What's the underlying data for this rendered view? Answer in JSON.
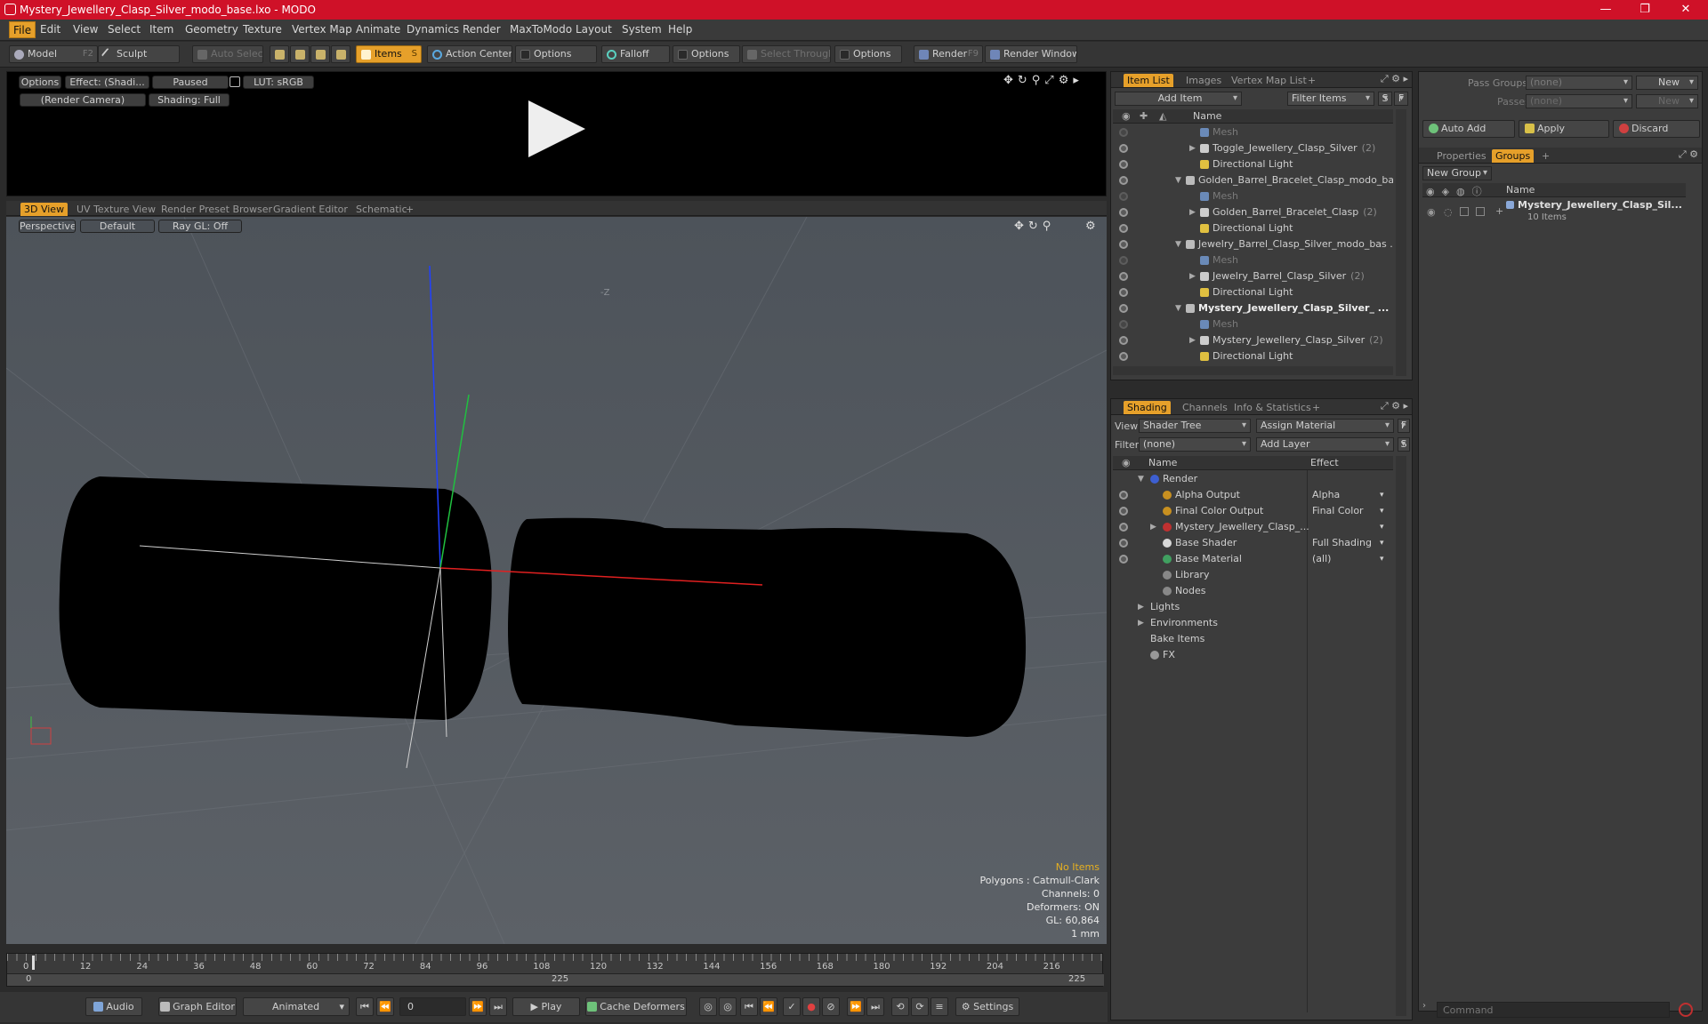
{
  "window": {
    "title": "Mystery_Jewellery_Clasp_Silver_modo_base.lxo - MODO"
  },
  "menu": [
    "File",
    "Edit",
    "View",
    "Select",
    "Item",
    "Geometry",
    "Texture",
    "Vertex Map",
    "Animate",
    "Dynamics",
    "Render",
    "MaxToModo",
    "Layout",
    "System",
    "Help"
  ],
  "toolbar": {
    "model": "Model",
    "model_key": "F2",
    "sculpt": "Sculpt",
    "auto_select": "Auto Select",
    "items": "Items",
    "items_key": "S",
    "action_center": "Action Center",
    "options1": "Options",
    "falloff": "Falloff",
    "options2": "Options",
    "select_through": "Select Through",
    "options3": "Options",
    "render": "Render",
    "render_key": "F9",
    "render_window": "Render Window"
  },
  "preview": {
    "options": "Options",
    "effect": "Effect: (Shadi...",
    "paused": "Paused",
    "lut": "LUT: sRGB",
    "camera": "(Render Camera)",
    "shading": "Shading: Full"
  },
  "viewport_tabs": [
    "3D View",
    "UV Texture View",
    "Render Preset Browser",
    "Gradient Editor",
    "Schematic",
    "+"
  ],
  "viewport": {
    "perspective": "Perspective",
    "default": "Default",
    "raygl": "Ray GL: Off",
    "axis_label": "-Z",
    "stats": {
      "items": "No Items",
      "polygons": "Polygons : Catmull-Clark",
      "channels": "Channels: 0",
      "deformers": "Deformers: ON",
      "gl": "GL: 60,864",
      "unit": "1 mm"
    }
  },
  "timeline": {
    "ticks": [
      "0",
      "12",
      "24",
      "36",
      "48",
      "60",
      "72",
      "84",
      "96",
      "108",
      "120",
      "132",
      "144",
      "156",
      "168",
      "180",
      "192",
      "204",
      "216"
    ],
    "start": "0",
    "mid": "225",
    "end": "225"
  },
  "bottom": {
    "audio": "Audio",
    "graph_editor": "Graph Editor",
    "animated": "Animated",
    "frame": "0",
    "play": "Play",
    "cache": "Cache Deformers",
    "settings": "Settings"
  },
  "item_list": {
    "tabs": [
      "Item List",
      "Images",
      "Vertex Map List",
      "+"
    ],
    "add_item": "Add Item",
    "filter": "Filter Items",
    "s": "S",
    "f": "F",
    "col_name": "Name",
    "rows": [
      {
        "label": "Mesh",
        "indent": 2,
        "type": "mesh",
        "dim": true
      },
      {
        "label": "Toggle_Jewellery_Clasp_Silver",
        "count": "(2)",
        "indent": 2,
        "type": "loc",
        "arrow": "▶"
      },
      {
        "label": "Directional Light",
        "indent": 2,
        "type": "light"
      },
      {
        "label": "Golden_Barrel_Bracelet_Clasp_modo_ba...",
        "indent": 1,
        "type": "scene",
        "arrow": "▼"
      },
      {
        "label": "Mesh",
        "indent": 2,
        "type": "mesh",
        "dim": true
      },
      {
        "label": "Golden_Barrel_Bracelet_Clasp",
        "count": "(2)",
        "indent": 2,
        "type": "loc",
        "arrow": "▶"
      },
      {
        "label": "Directional Light",
        "indent": 2,
        "type": "light"
      },
      {
        "label": "Jewelry_Barrel_Clasp_Silver_modo_bas ...",
        "indent": 1,
        "type": "scene",
        "arrow": "▼"
      },
      {
        "label": "Mesh",
        "indent": 2,
        "type": "mesh",
        "dim": true
      },
      {
        "label": "Jewelry_Barrel_Clasp_Silver",
        "count": "(2)",
        "indent": 2,
        "type": "loc",
        "arrow": "▶"
      },
      {
        "label": "Directional Light",
        "indent": 2,
        "type": "light"
      },
      {
        "label": "Mystery_Jewellery_Clasp_Silver_ ...",
        "indent": 1,
        "type": "scene",
        "arrow": "▼",
        "bold": true
      },
      {
        "label": "Mesh",
        "indent": 2,
        "type": "mesh",
        "dim": true
      },
      {
        "label": "Mystery_Jewellery_Clasp_Silver",
        "count": "(2)",
        "indent": 2,
        "type": "loc",
        "arrow": "▶"
      },
      {
        "label": "Directional Light",
        "indent": 2,
        "type": "light"
      }
    ]
  },
  "shading": {
    "tabs": [
      "Shading",
      "Channels",
      "Info & Statistics",
      "+"
    ],
    "view_label": "View",
    "view_value": "Shader Tree",
    "assign": "Assign Material",
    "f": "F",
    "filter_label": "Filter",
    "filter_value": "(none)",
    "add_layer": "Add Layer",
    "s": "S",
    "col_name": "Name",
    "col_effect": "Effect",
    "rows": [
      {
        "label": "Render",
        "effect": "",
        "indent": 0,
        "icon": "#3d5fd1",
        "arrow": "▼",
        "eye": false
      },
      {
        "label": "Alpha Output",
        "effect": "Alpha",
        "indent": 1,
        "icon": "#c89020",
        "eye": true
      },
      {
        "label": "Final Color Output",
        "effect": "Final Color",
        "indent": 1,
        "icon": "#c89020",
        "eye": true
      },
      {
        "label": "Mystery_Jewellery_Clasp_...",
        "effect": "",
        "indent": 1,
        "icon": "#c03030",
        "arrow": "▶",
        "eye": true,
        "dd": true
      },
      {
        "label": "Base Shader",
        "effect": "Full Shading",
        "indent": 1,
        "icon": "#d8d8d8",
        "eye": true
      },
      {
        "label": "Base Material",
        "effect": "(all)",
        "indent": 1,
        "icon": "#40a060",
        "eye": true
      },
      {
        "label": "Library",
        "effect": "",
        "indent": 1,
        "icon": "#888",
        "eye": false
      },
      {
        "label": "Nodes",
        "effect": "",
        "indent": 1,
        "icon": "#888",
        "eye": false
      },
      {
        "label": "Lights",
        "effect": "",
        "indent": 0,
        "icon": "",
        "arrow": "▶",
        "eye": false
      },
      {
        "label": "Environments",
        "effect": "",
        "indent": 0,
        "icon": "",
        "arrow": "▶",
        "eye": false
      },
      {
        "label": "Bake Items",
        "effect": "",
        "indent": 0,
        "icon": "",
        "eye": false
      },
      {
        "label": "FX",
        "effect": "",
        "indent": 0,
        "icon": "#999",
        "eye": false
      }
    ]
  },
  "groups": {
    "pass_groups": "Pass Groups",
    "pass_value": "(none)",
    "new": "New",
    "passes": "Passes",
    "passes_value": "(none)",
    "new2": "New",
    "auto_add": "Auto Add",
    "apply": "Apply",
    "discard": "Discard",
    "tabs": [
      "Properties",
      "Groups",
      "+"
    ],
    "new_group": "New Group",
    "col_name": "Name",
    "item_name": "Mystery_Jewellery_Clasp_Sil...",
    "item_sub": "10 Items"
  },
  "command": {
    "placeholder": "Command"
  }
}
